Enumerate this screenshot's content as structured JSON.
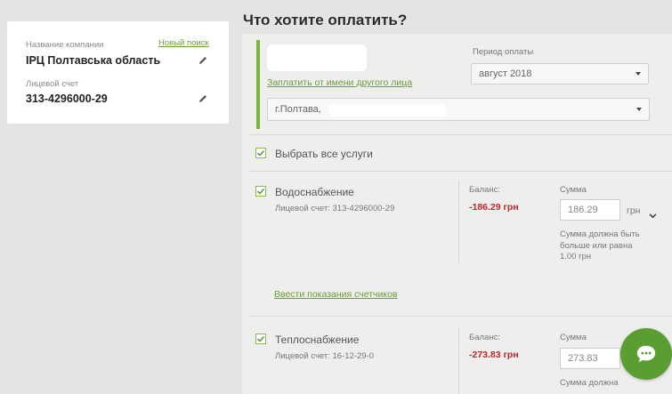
{
  "company_card": {
    "company_label": "Название компании",
    "new_search_link": "Новый поиск",
    "company_name": "ІРЦ Полтавська область",
    "account_label": "Лицевой счет",
    "account_number": "313-4296000-29"
  },
  "main": {
    "title": "Что хотите оплатить?",
    "pay_for_other_link": "Заплатить от имени другого лица",
    "period_label": "Период оплаты",
    "period_value": "август 2018",
    "address_value": "г.Полтава,",
    "select_all_label": "Выбрать все услуги"
  },
  "services": [
    {
      "name": "Водоснабжение",
      "account": "Лицевой счет: 313-4296000-29",
      "balance_label": "Баланс:",
      "balance_value": "-186.29 грн",
      "sum_label": "Сумма",
      "sum_value": "186.29",
      "currency": "грн",
      "note": "Сумма должна быть больше или равна 1.00 грн",
      "meter_link": "Ввести показания счетчиков"
    },
    {
      "name": "Теплоснабжение",
      "account": "Лицевой счет: 16-12-29-0",
      "balance_label": "Баланс:",
      "balance_value": "-273.83 грн",
      "sum_label": "Сумма",
      "sum_value": "273.83",
      "note": "Сумма должна"
    }
  ],
  "colors": {
    "accent_green": "#7db240",
    "balance_red": "#c0262c",
    "fab_green": "#5a9e32"
  },
  "icons": [
    "pencil-icon",
    "check-icon",
    "chevron-down-icon",
    "chat-icon"
  ]
}
